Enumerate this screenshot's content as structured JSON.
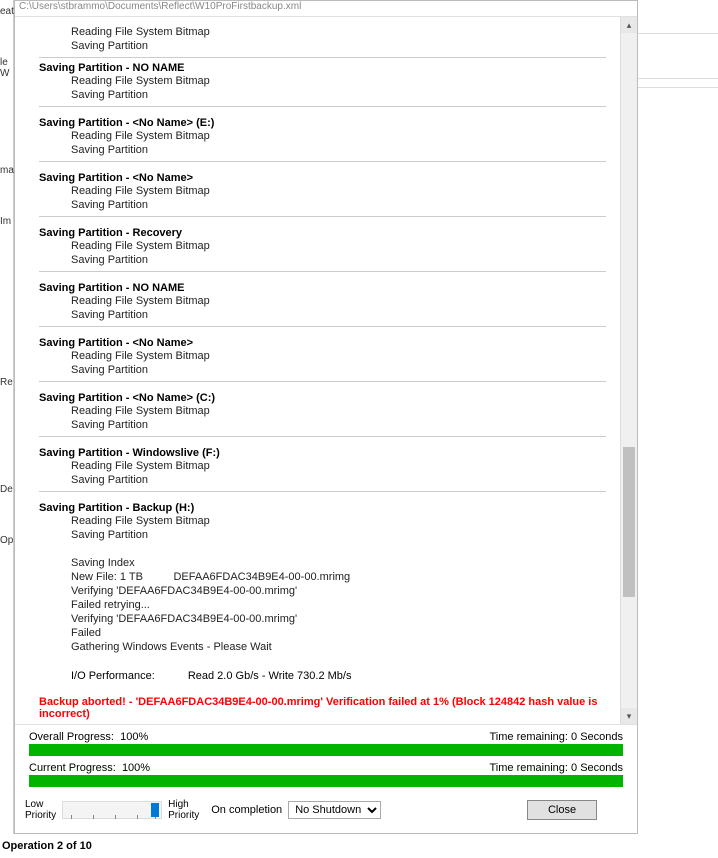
{
  "path": "C:\\Users\\stbrammo\\Documents\\Reflect\\W10ProFirstbackup.xml",
  "leftFragments": [
    "eat",
    "le W",
    "ma",
    "Im",
    "Re",
    "De",
    "Op"
  ],
  "topSub": [
    "Reading File System Bitmap",
    "Saving Partition"
  ],
  "sections": [
    {
      "title": "Saving Partition - NO NAME",
      "subs": [
        "Reading File System Bitmap",
        "Saving Partition"
      ]
    },
    {
      "title": "Saving Partition - <No Name> (E:)",
      "subs": [
        "Reading File System Bitmap",
        "Saving Partition"
      ]
    },
    {
      "title": "Saving Partition - <No Name>",
      "subs": [
        "Reading File System Bitmap",
        "Saving Partition"
      ]
    },
    {
      "title": "Saving Partition - Recovery",
      "subs": [
        "Reading File System Bitmap",
        "Saving Partition"
      ]
    },
    {
      "title": "Saving Partition - NO NAME",
      "subs": [
        "Reading File System Bitmap",
        "Saving Partition"
      ]
    },
    {
      "title": "Saving Partition - <No Name>",
      "subs": [
        "Reading File System Bitmap",
        "Saving Partition"
      ]
    },
    {
      "title": "Saving Partition - <No Name> (C:)",
      "subs": [
        "Reading File System Bitmap",
        "Saving Partition"
      ]
    },
    {
      "title": "Saving Partition - Windowslive (F:)",
      "subs": [
        "Reading File System Bitmap",
        "Saving Partition"
      ]
    },
    {
      "title": "Saving Partition - Backup (H:)",
      "subs": [
        "Reading File System Bitmap",
        "Saving Partition"
      ]
    }
  ],
  "details": [
    "Saving Index",
    "New File: 1 TB          DEFAA6FDAC34B9E4-00-00.mrimg",
    "Verifying 'DEFAA6FDAC34B9E4-00-00.mrimg'",
    "Failed retrying...",
    "Verifying 'DEFAA6FDAC34B9E4-00-00.mrimg'",
    "Failed",
    "Gathering Windows Events - Please Wait"
  ],
  "io": {
    "label": "I/O Performance:",
    "value": "Read 2.0 Gb/s - Write 730.2 Mb/s"
  },
  "error": "Backup aborted! - 'DEFAA6FDAC34B9E4-00-00.mrimg' Verification failed at 1% (Block 124842 hash value is incorrect)",
  "overall": {
    "label": "Overall Progress:",
    "value": "100%",
    "time_label": "Time remaining:",
    "time_value": "0 Seconds"
  },
  "current": {
    "label": "Current Progress:",
    "value": "100%",
    "time_label": "Time remaining:",
    "time_value": "0 Seconds"
  },
  "priority": {
    "low": "Low\nPriority",
    "high": "High\nPriority"
  },
  "oncompletion": {
    "label": "On completion",
    "selected": "No Shutdown"
  },
  "close": "Close",
  "footer": "Operation 2 of 10"
}
